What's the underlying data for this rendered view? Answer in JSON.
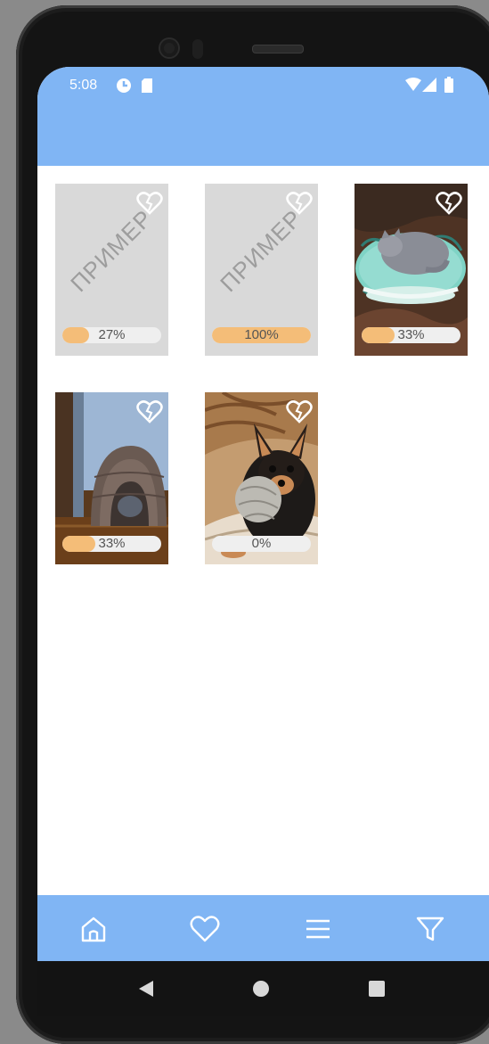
{
  "status_bar": {
    "time": "5:08"
  },
  "gallery": {
    "items": [
      {
        "kind": "placeholder",
        "watermark": "ПРИМЕР",
        "progress": 27,
        "progress_label": "27%"
      },
      {
        "kind": "placeholder",
        "watermark": "ПРИМЕР",
        "progress": 100,
        "progress_label": "100%"
      },
      {
        "kind": "photo",
        "subject": "cat sleeping on blanket",
        "progress": 33,
        "progress_label": "33%"
      },
      {
        "kind": "photo",
        "subject": "cat in pet tunnel",
        "progress": 33,
        "progress_label": "33%"
      },
      {
        "kind": "photo",
        "subject": "dog with ball of yarn",
        "progress": 0,
        "progress_label": "0%"
      }
    ]
  },
  "bottom_nav": {
    "items": [
      {
        "icon": "home-icon"
      },
      {
        "icon": "heart-icon"
      },
      {
        "icon": "menu-icon"
      },
      {
        "icon": "filter-icon"
      }
    ]
  },
  "colors": {
    "accent": "#80b5f4",
    "progress_fill": "#f4bd78",
    "placeholder": "#d9d9d9"
  }
}
